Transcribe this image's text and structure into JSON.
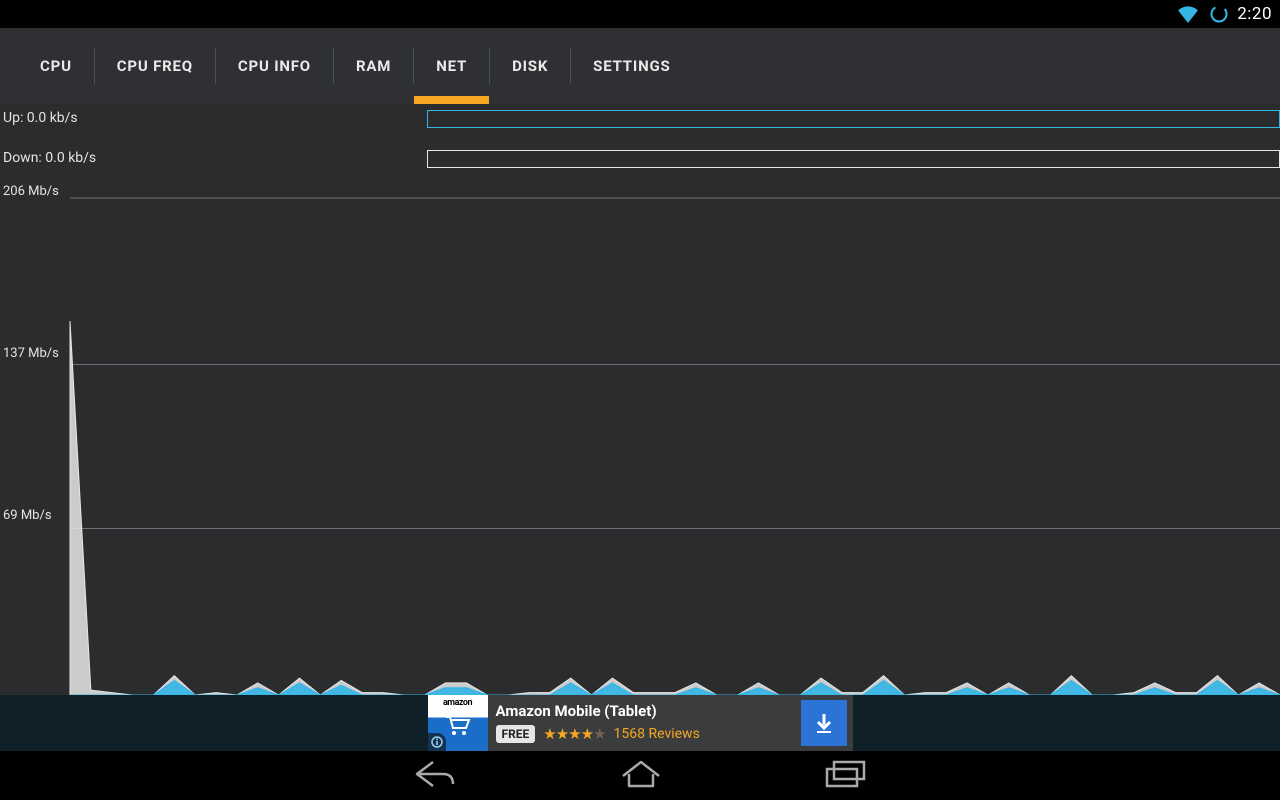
{
  "status": {
    "time": "2:20"
  },
  "tabs": [
    {
      "label": "CPU",
      "active": false
    },
    {
      "label": "CPU FREQ",
      "active": false
    },
    {
      "label": "CPU INFO",
      "active": false
    },
    {
      "label": "RAM",
      "active": false
    },
    {
      "label": "NET",
      "active": true
    },
    {
      "label": "DISK",
      "active": false
    },
    {
      "label": "SETTINGS",
      "active": false
    }
  ],
  "net": {
    "up_label": "Up: 0.0 kb/s",
    "down_label": "Down: 0.0 kb/s"
  },
  "chart_data": {
    "type": "line",
    "title": "",
    "xlabel": "",
    "ylabel": "",
    "ylim": [
      0,
      206
    ],
    "y_ticks": [
      69,
      137,
      206
    ],
    "y_tick_labels": [
      "69 Mb/s",
      "137 Mb/s",
      "206 Mb/s"
    ],
    "x": [
      0,
      1,
      2,
      3,
      4,
      5,
      6,
      7,
      8,
      9,
      10,
      11,
      12,
      13,
      14,
      15,
      16,
      17,
      18,
      19,
      20,
      21,
      22,
      23,
      24,
      25,
      26,
      27,
      28,
      29,
      30,
      31,
      32,
      33,
      34,
      35,
      36,
      37,
      38,
      39,
      40,
      41,
      42,
      43,
      44,
      45,
      46,
      47,
      48,
      49,
      50,
      51,
      52,
      53,
      54,
      55,
      56,
      57,
      58
    ],
    "series": [
      {
        "name": "Down",
        "color": "#e7e7e7",
        "values": [
          155,
          2,
          1,
          0,
          0,
          8,
          0,
          1,
          0,
          5,
          0,
          7,
          0,
          6,
          1,
          1,
          0,
          0,
          5,
          5,
          0,
          0,
          1,
          1,
          7,
          0,
          7,
          1,
          1,
          1,
          5,
          0,
          0,
          5,
          0,
          0,
          7,
          1,
          1,
          8,
          0,
          1,
          1,
          5,
          0,
          5,
          0,
          0,
          8,
          0,
          0,
          1,
          5,
          1,
          1,
          8,
          0,
          5,
          0
        ]
      },
      {
        "name": "Up",
        "color": "#33b5e5",
        "values": [
          0,
          0,
          0,
          0,
          0,
          6,
          0,
          0,
          0,
          3,
          0,
          5,
          0,
          4,
          0,
          0,
          0,
          0,
          3,
          3,
          0,
          0,
          0,
          0,
          5,
          0,
          5,
          0,
          0,
          0,
          3,
          0,
          0,
          3,
          0,
          0,
          5,
          0,
          0,
          6,
          0,
          0,
          0,
          3,
          0,
          3,
          0,
          0,
          6,
          0,
          0,
          0,
          3,
          0,
          0,
          6,
          0,
          3,
          0
        ]
      }
    ]
  },
  "ad": {
    "brand": "amazon",
    "title": "Amazon Mobile (Tablet)",
    "price": "FREE",
    "stars_full": 4,
    "stars_total": 5,
    "reviews_text": "1568 Reviews"
  }
}
